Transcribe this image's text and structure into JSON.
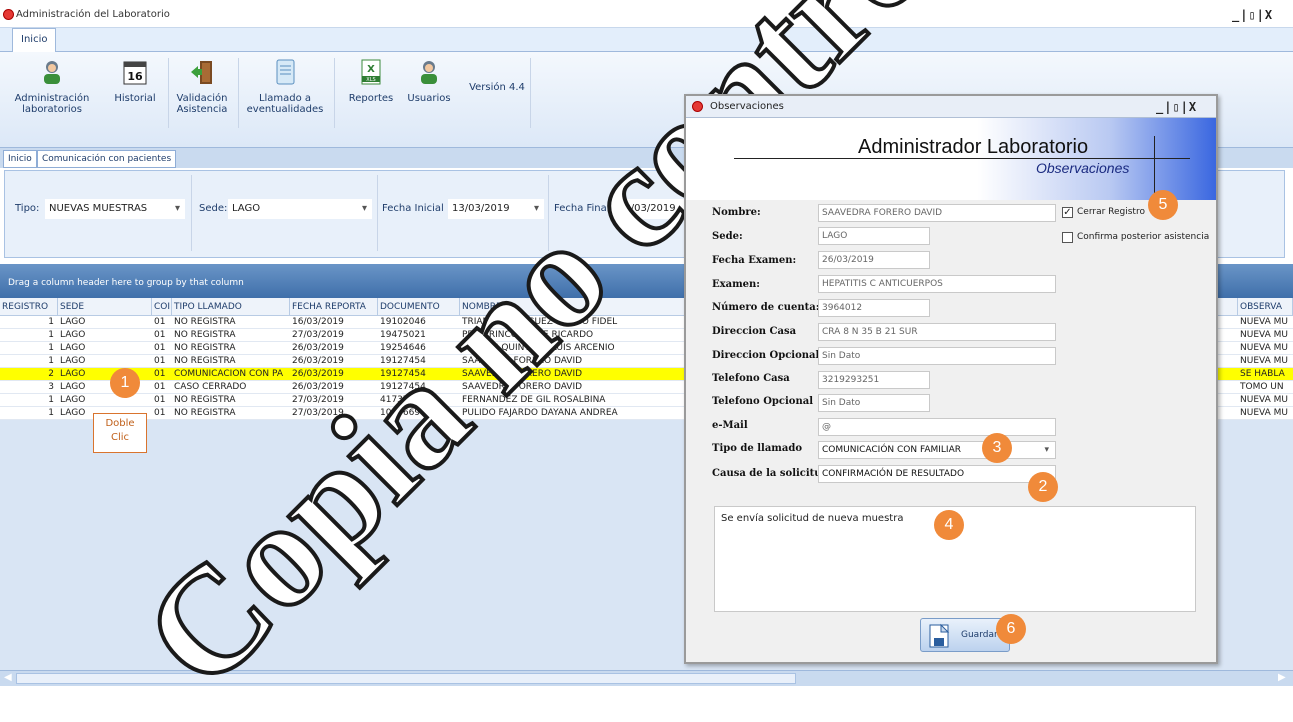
{
  "window": {
    "title": "Administración del Laboratorio",
    "controls": "_|▯|X"
  },
  "ribbon": {
    "tab_inicio": "Inicio",
    "buttons": [
      {
        "label1": "Administración",
        "label2": "laboratorios",
        "icon": "users-icon"
      },
      {
        "label1": "Historial",
        "label2": "",
        "icon": "calendar-icon"
      },
      {
        "label1": "Validación",
        "label2": "Asistencia",
        "icon": "door-exit-icon"
      },
      {
        "label1": "Llamado a",
        "label2": "eventualidades",
        "icon": "notebook-icon"
      },
      {
        "label1": "Reportes",
        "label2": "",
        "icon": "excel-icon"
      },
      {
        "label1": "Usuarios",
        "label2": "",
        "icon": "user-group-icon"
      }
    ],
    "version": "Versión 4.4"
  },
  "subtabs": [
    "Inicio",
    "Comunicación con pacientes"
  ],
  "filters": {
    "tipo_label": "Tipo:",
    "tipo_value": "NUEVAS MUESTRAS",
    "sede_label": "Sede:",
    "sede_value": "LAGO",
    "fecha_inicial_label": "Fecha Inicial",
    "fecha_inicial_value": "13/03/2019",
    "fecha_final_label": "Fecha Final",
    "fecha_final_value": "28/03/2019"
  },
  "grid": {
    "group_hint": "Drag a column header here to group by that column",
    "columns": [
      "REGISTRO",
      "SEDE",
      "COI",
      "TIPO LLAMADO",
      "FECHA REPORTA",
      "DOCUMENTO",
      "NOMBRE",
      "OBSERVA"
    ],
    "rows": [
      [
        "1",
        "LAGO",
        "01",
        "NO REGISTRA",
        "16/03/2019",
        "19102046",
        "TRIANA RODRIGUEZ MARCO FIDEL",
        "NUEVA MU"
      ],
      [
        "1",
        "LAGO",
        "01",
        "NO REGISTRA",
        "27/03/2019",
        "19475021",
        "PEÑA RINCON JOSE RICARDO",
        "NUEVA MU"
      ],
      [
        "1",
        "LAGO",
        "01",
        "NO REGISTRA",
        "26/03/2019",
        "19254646",
        "TORRES QUINTERO LUIS ARCENIO",
        "NUEVA MU"
      ],
      [
        "1",
        "LAGO",
        "01",
        "NO REGISTRA",
        "26/03/2019",
        "19127454",
        "SAAVEDRA FORERO DAVID",
        "NUEVA MU"
      ],
      [
        "2",
        "LAGO",
        "01",
        "COMUNICACIÓN CON PA",
        "26/03/2019",
        "19127454",
        "SAAVEDRA FORERO DAVID",
        "SE HABLA"
      ],
      [
        "3",
        "LAGO",
        "01",
        "CASO CERRADO",
        "26/03/2019",
        "19127454",
        "SAAVEDRA FORERO DAVID",
        "TOMO UN"
      ],
      [
        "1",
        "LAGO",
        "01",
        "NO REGISTRA",
        "27/03/2019",
        "41737750",
        "FERNANDEZ DE GIL ROSALBINA",
        "NUEVA MU"
      ],
      [
        "1",
        "LAGO",
        "01",
        "NO REGISTRA",
        "27/03/2019",
        "1028669783",
        "PULIDO FAJARDO DAYANA ANDREA",
        "NUEVA MU"
      ]
    ],
    "selected_row": 4
  },
  "annotation_doble": {
    "line1": "Doble",
    "line2": "Clic"
  },
  "badges": [
    "1",
    "2",
    "3",
    "4",
    "5",
    "6"
  ],
  "modal": {
    "title": "Observaciones",
    "controls": "_|▯|X",
    "banner_title": "Administrador Laboratorio",
    "banner_subtitle": "Observaciones",
    "fields": {
      "nombre_label": "Nombre:",
      "nombre": "SAAVEDRA FORERO DAVID",
      "sede_label": "Sede:",
      "sede": "LAGO",
      "fecha_label": "Fecha Examen:",
      "fecha": "26/03/2019",
      "examen_label": "Examen:",
      "examen": "HEPATITIS C ANTICUERPOS",
      "cuenta_label": "Número de cuenta:",
      "cuenta": "3964012",
      "dircasa_label": "Direccion Casa",
      "dircasa": "CRA 8 N 35 B 21 SUR",
      "diropc_label": "Direccion Opcional",
      "diropc": "Sin Dato",
      "telcasa_label": "Telefono Casa",
      "telcasa": "3219293251",
      "telopc_label": "Telefono Opcional",
      "telopc": "Sin Dato",
      "email_label": "e-Mail",
      "email": "@",
      "tipo_label": "Tipo de llamado",
      "tipo": "COMUNICACIÓN CON FAMILIAR",
      "causa_label": "Causa de la solicitud",
      "causa": "CONFIRMACIÓN DE RESULTADO"
    },
    "cerrar_registro": "Cerrar Registro",
    "confirma": "Confirma posterior asistencia",
    "observacion": "Se envía solicitud de nueva muestra",
    "guardar": "Guardar"
  },
  "watermark": "Copia no controlada"
}
